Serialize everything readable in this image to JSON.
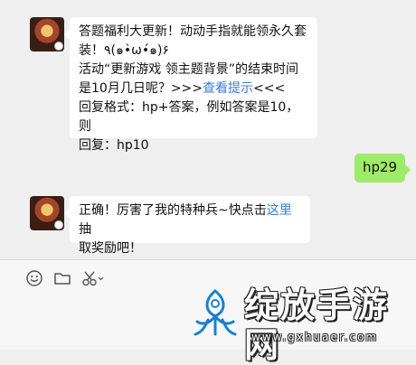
{
  "messages": [
    {
      "side": "left",
      "lines": [
        "答题福利大更新！动动手指就能领永久套",
        "装！٩(๑•̀ω•́๑)۶",
        "活动“更新游戏 领主题背景”的结束时间",
        "是10月几日呢？>>>|查看提示|<<<",
        "回复格式：hp+答案，例如答案是10，则",
        "回复：hp10"
      ],
      "line_parts": {
        "l4_pre": "是10月几日呢？>>>",
        "l4_link": "查看提示",
        "l4_post": "<<<"
      }
    },
    {
      "side": "right",
      "text": "hp29"
    },
    {
      "side": "left",
      "line1_pre": "正确！厉害了我的特种兵~快点击",
      "line1_link": "这里",
      "line1_post": "抽",
      "line2": "取奖励吧！"
    }
  ],
  "toolbar": {
    "icons": [
      "emoji-icon",
      "folder-icon",
      "scissors-icon"
    ]
  },
  "watermark": {
    "text": "绽放手游网",
    "url": "www.gxhuaer.com"
  },
  "colors": {
    "background": "#efefef",
    "bubble_self": "#9eea6a",
    "link": "#3b7bd6"
  }
}
